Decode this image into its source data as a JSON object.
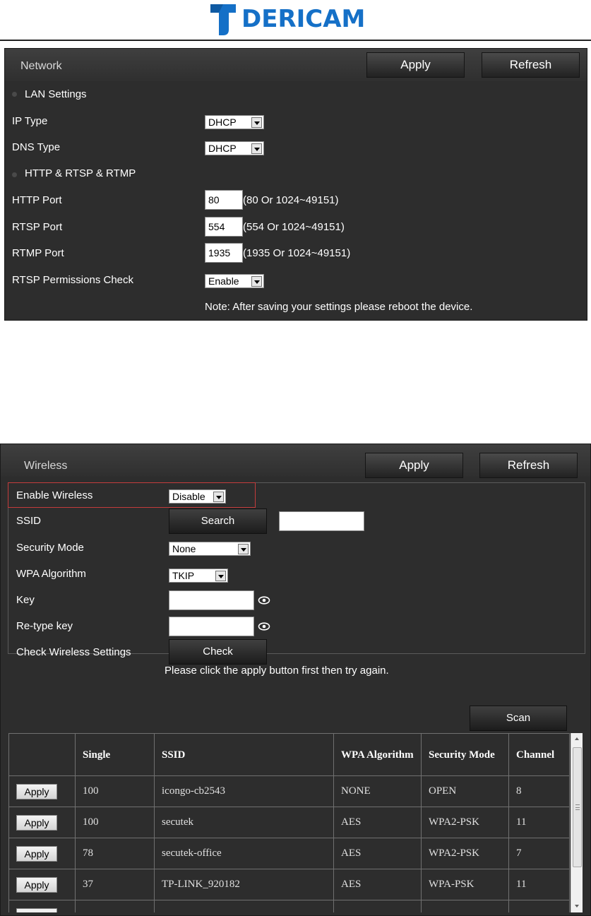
{
  "brand": {
    "name": "DERICAM",
    "color": "#1570c7"
  },
  "network": {
    "title": "Network",
    "apply_label": "Apply",
    "refresh_label": "Refresh",
    "lan_section": "LAN Settings",
    "ip_type_label": "IP Type",
    "ip_type_value": "DHCP",
    "dns_type_label": "DNS Type",
    "dns_type_value": "DHCP",
    "http_section": "HTTP & RTSP & RTMP",
    "http_port_label": "HTTP Port",
    "http_port_value": "80",
    "http_port_hint": "(80 Or 1024~49151)",
    "rtsp_port_label": "RTSP Port",
    "rtsp_port_value": "554",
    "rtsp_port_hint": "(554 Or 1024~49151)",
    "rtmp_port_label": "RTMP Port",
    "rtmp_port_value": "1935",
    "rtmp_port_hint": "(1935 Or 1024~49151)",
    "rtsp_check_label": "RTSP Permissions Check",
    "rtsp_check_value": "Enable",
    "note": "Note: After saving your settings please reboot the device."
  },
  "wireless": {
    "title": "Wireless",
    "apply_label": "Apply",
    "refresh_label": "Refresh",
    "enable_label": "Enable Wireless",
    "enable_value": "Disable",
    "ssid_label": "SSID",
    "search_label": "Search",
    "ssid_value": "",
    "security_mode_label": "Security Mode",
    "security_mode_value": "None",
    "wpa_algorithm_label": "WPA Algorithm",
    "wpa_algorithm_value": "TKIP",
    "key_label": "Key",
    "key_value": "",
    "retype_key_label": "Re-type key",
    "retype_key_value": "",
    "check_label": "Check Wireless Settings",
    "check_button": "Check",
    "note": "Please click the apply button first then try again.",
    "scan_label": "Scan",
    "table": {
      "headers": [
        "",
        "Single",
        "SSID",
        "WPA Algorithm",
        "Security Mode",
        "Channel"
      ],
      "row_action": "Apply",
      "rows": [
        {
          "single": "100",
          "ssid": "icongo-cb2543",
          "wpa": "NONE",
          "security": "OPEN",
          "channel": "8"
        },
        {
          "single": "100",
          "ssid": "secutek",
          "wpa": "AES",
          "security": "WPA2-PSK",
          "channel": "11"
        },
        {
          "single": "78",
          "ssid": "secutek-office",
          "wpa": "AES",
          "security": "WPA2-PSK",
          "channel": "7"
        },
        {
          "single": "37",
          "ssid": "TP-LINK_920182",
          "wpa": "AES",
          "security": "WPA-PSK",
          "channel": "11"
        }
      ]
    }
  },
  "colors": {
    "panel": "#2d2d2d",
    "highlight": "#c43c3c"
  }
}
